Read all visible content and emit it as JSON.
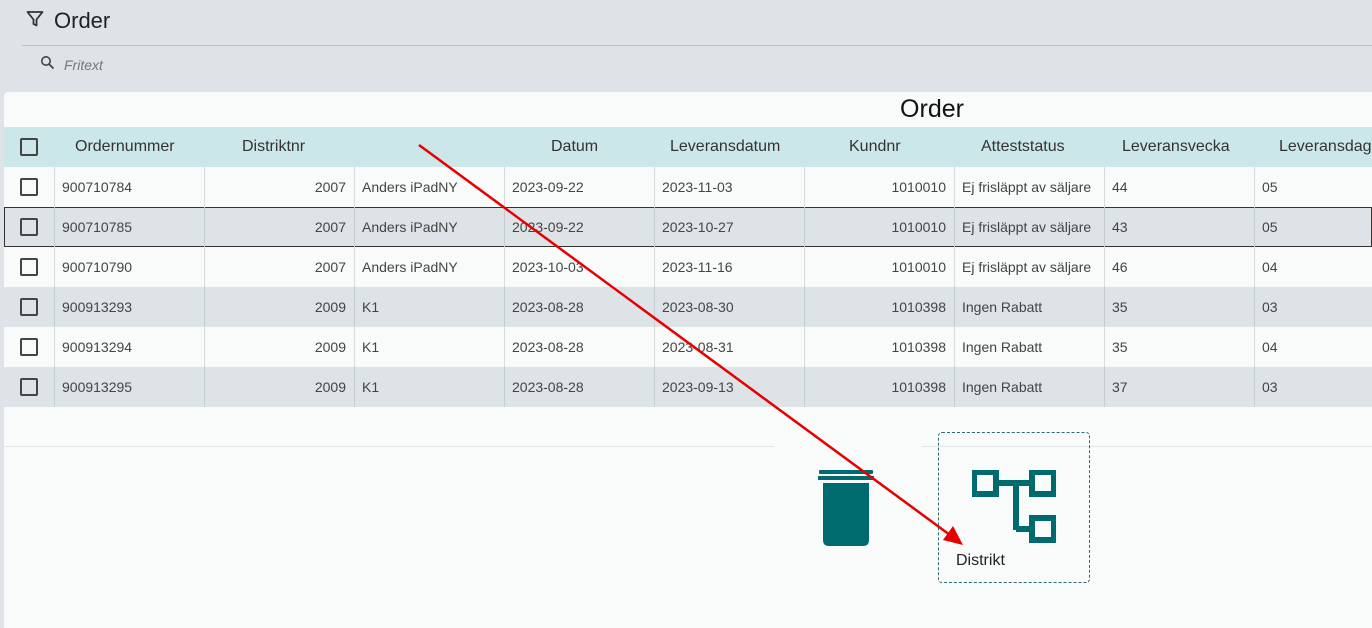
{
  "header": {
    "title": "Order",
    "filter_icon": "filter-icon"
  },
  "search": {
    "placeholder": "Fritext",
    "value": ""
  },
  "panel": {
    "title": "Order"
  },
  "table": {
    "columns": [
      "Ordernummer",
      "Distriktnr",
      "",
      "Datum",
      "Leveransdatum",
      "Kundnr",
      "Atteststatus",
      "Leveransvecka",
      "Leveransdag"
    ],
    "rows": [
      [
        "900710784",
        "2007",
        "Anders iPadNY",
        "2023-09-22",
        "2023-11-03",
        "1010010",
        "Ej frisläppt av säljare",
        "44",
        "05"
      ],
      [
        "900710785",
        "2007",
        "Anders iPadNY",
        "2023-09-22",
        "2023-10-27",
        "1010010",
        "Ej frisläppt av säljare",
        "43",
        "05"
      ],
      [
        "900710790",
        "2007",
        "Anders iPadNY",
        "2023-10-03",
        "2023-11-16",
        "1010010",
        "Ej frisläppt av säljare",
        "46",
        "04"
      ],
      [
        "900913293",
        "2009",
        "K1",
        "2023-08-28",
        "2023-08-30",
        "1010398",
        "Ingen Rabatt",
        "35",
        "03"
      ],
      [
        "900913294",
        "2009",
        "K1",
        "2023-08-28",
        "2023-08-31",
        "1010398",
        "Ingen Rabatt",
        "35",
        "04"
      ],
      [
        "900913295",
        "2009",
        "K1",
        "2023-08-28",
        "2023-09-13",
        "1010398",
        "Ingen Rabatt",
        "37",
        "03"
      ]
    ]
  },
  "dropzone": {
    "label": "Distrikt",
    "icon": "hierarchy-icon"
  },
  "trash": {
    "icon": "trash-icon"
  },
  "colors": {
    "accent": "#006b6f",
    "header_bg": "#cce7ea",
    "arrow": "#e60000"
  }
}
